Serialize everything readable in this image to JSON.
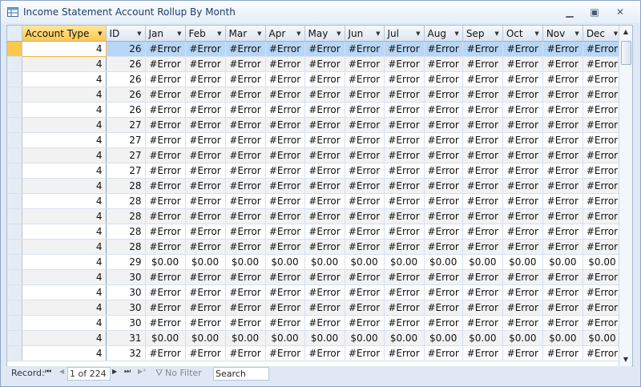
{
  "window": {
    "title": "Income Statement Account Rollup By Month"
  },
  "columns": [
    "Account Type",
    "ID",
    "Jan",
    "Feb",
    "Mar",
    "Apr",
    "May",
    "Jun",
    "Jul",
    "Aug",
    "Sep",
    "Oct",
    "Nov",
    "Dec"
  ],
  "rows": [
    [
      "4",
      "26",
      "#Error",
      "#Error",
      "#Error",
      "#Error",
      "#Error",
      "#Error",
      "#Error",
      "#Error",
      "#Error",
      "#Error",
      "#Error",
      "#Error"
    ],
    [
      "4",
      "26",
      "#Error",
      "#Error",
      "#Error",
      "#Error",
      "#Error",
      "#Error",
      "#Error",
      "#Error",
      "#Error",
      "#Error",
      "#Error",
      "#Error"
    ],
    [
      "4",
      "26",
      "#Error",
      "#Error",
      "#Error",
      "#Error",
      "#Error",
      "#Error",
      "#Error",
      "#Error",
      "#Error",
      "#Error",
      "#Error",
      "#Error"
    ],
    [
      "4",
      "26",
      "#Error",
      "#Error",
      "#Error",
      "#Error",
      "#Error",
      "#Error",
      "#Error",
      "#Error",
      "#Error",
      "#Error",
      "#Error",
      "#Error"
    ],
    [
      "4",
      "26",
      "#Error",
      "#Error",
      "#Error",
      "#Error",
      "#Error",
      "#Error",
      "#Error",
      "#Error",
      "#Error",
      "#Error",
      "#Error",
      "#Error"
    ],
    [
      "4",
      "27",
      "#Error",
      "#Error",
      "#Error",
      "#Error",
      "#Error",
      "#Error",
      "#Error",
      "#Error",
      "#Error",
      "#Error",
      "#Error",
      "#Error"
    ],
    [
      "4",
      "27",
      "#Error",
      "#Error",
      "#Error",
      "#Error",
      "#Error",
      "#Error",
      "#Error",
      "#Error",
      "#Error",
      "#Error",
      "#Error",
      "#Error"
    ],
    [
      "4",
      "27",
      "#Error",
      "#Error",
      "#Error",
      "#Error",
      "#Error",
      "#Error",
      "#Error",
      "#Error",
      "#Error",
      "#Error",
      "#Error",
      "#Error"
    ],
    [
      "4",
      "27",
      "#Error",
      "#Error",
      "#Error",
      "#Error",
      "#Error",
      "#Error",
      "#Error",
      "#Error",
      "#Error",
      "#Error",
      "#Error",
      "#Error"
    ],
    [
      "4",
      "28",
      "#Error",
      "#Error",
      "#Error",
      "#Error",
      "#Error",
      "#Error",
      "#Error",
      "#Error",
      "#Error",
      "#Error",
      "#Error",
      "#Error"
    ],
    [
      "4",
      "28",
      "#Error",
      "#Error",
      "#Error",
      "#Error",
      "#Error",
      "#Error",
      "#Error",
      "#Error",
      "#Error",
      "#Error",
      "#Error",
      "#Error"
    ],
    [
      "4",
      "28",
      "#Error",
      "#Error",
      "#Error",
      "#Error",
      "#Error",
      "#Error",
      "#Error",
      "#Error",
      "#Error",
      "#Error",
      "#Error",
      "#Error"
    ],
    [
      "4",
      "28",
      "#Error",
      "#Error",
      "#Error",
      "#Error",
      "#Error",
      "#Error",
      "#Error",
      "#Error",
      "#Error",
      "#Error",
      "#Error",
      "#Error"
    ],
    [
      "4",
      "28",
      "#Error",
      "#Error",
      "#Error",
      "#Error",
      "#Error",
      "#Error",
      "#Error",
      "#Error",
      "#Error",
      "#Error",
      "#Error",
      "#Error"
    ],
    [
      "4",
      "29",
      "$0.00",
      "$0.00",
      "$0.00",
      "$0.00",
      "$0.00",
      "$0.00",
      "$0.00",
      "$0.00",
      "$0.00",
      "$0.00",
      "$0.00",
      "$0.00"
    ],
    [
      "4",
      "30",
      "#Error",
      "#Error",
      "#Error",
      "#Error",
      "#Error",
      "#Error",
      "#Error",
      "#Error",
      "#Error",
      "#Error",
      "#Error",
      "#Error"
    ],
    [
      "4",
      "30",
      "#Error",
      "#Error",
      "#Error",
      "#Error",
      "#Error",
      "#Error",
      "#Error",
      "#Error",
      "#Error",
      "#Error",
      "#Error",
      "#Error"
    ],
    [
      "4",
      "30",
      "#Error",
      "#Error",
      "#Error",
      "#Error",
      "#Error",
      "#Error",
      "#Error",
      "#Error",
      "#Error",
      "#Error",
      "#Error",
      "#Error"
    ],
    [
      "4",
      "30",
      "#Error",
      "#Error",
      "#Error",
      "#Error",
      "#Error",
      "#Error",
      "#Error",
      "#Error",
      "#Error",
      "#Error",
      "#Error",
      "#Error"
    ],
    [
      "4",
      "31",
      "$0.00",
      "$0.00",
      "$0.00",
      "$0.00",
      "$0.00",
      "$0.00",
      "$0.00",
      "$0.00",
      "$0.00",
      "$0.00",
      "$0.00",
      "$0.00"
    ],
    [
      "4",
      "32",
      "#Error",
      "#Error",
      "#Error",
      "#Error",
      "#Error",
      "#Error",
      "#Error",
      "#Error",
      "#Error",
      "#Error",
      "#Error",
      "#Error"
    ]
  ],
  "navigation": {
    "record_label": "Record:",
    "first": "⏮",
    "prev": "◀",
    "position": "1 of 224",
    "next": "▶",
    "last": "⏭",
    "new": "▶*",
    "filter": "No Filter",
    "search_placeholder": "Search"
  },
  "icons": {
    "minimize": "minimize-icon",
    "restore": "restore-icon",
    "close": "close-icon",
    "app": "datasheet-icon"
  }
}
